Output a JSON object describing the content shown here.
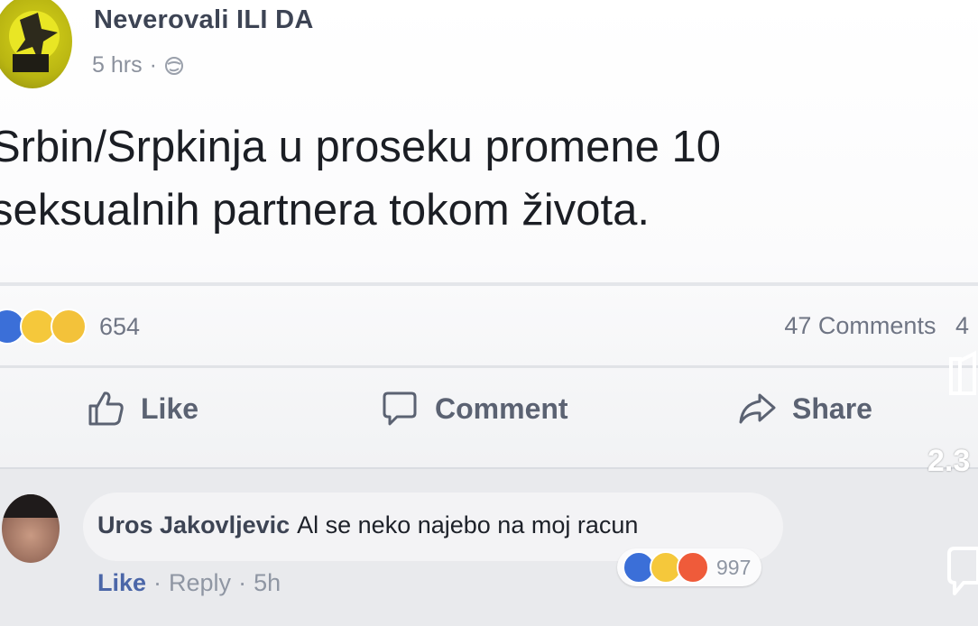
{
  "post": {
    "page_name": "Neverovali ILI DA",
    "time": "5 hrs",
    "separator": "·",
    "text_line1": "Srbin/Srpkinja u proseku promene 10",
    "text_line2": "seksualnih partnera tokom života.",
    "reaction_count": "654",
    "comments_count": "47 Comments",
    "comments_extra": "4"
  },
  "actions": {
    "like": "Like",
    "comment": "Comment",
    "share": "Share"
  },
  "comment": {
    "author": "Uros Jakovljevic",
    "text": "Al se neko najebo na moj racun",
    "like": "Like",
    "reply": "Reply",
    "time": "5h",
    "dot": "·",
    "reaction_count": "997"
  },
  "side": {
    "count": "2.3"
  },
  "colors": {
    "accent": "#4b66a8",
    "like_blue": "#3b6fd8",
    "haha_yellow": "#f5c83b",
    "angry": "#ef5b3a"
  },
  "icons": {
    "avatar": "page-avatar-cartoon",
    "globe": "globe-icon",
    "like": "thumbs-up-icon",
    "comment": "comment-bubble-icon",
    "share": "share-arrow-icon"
  }
}
